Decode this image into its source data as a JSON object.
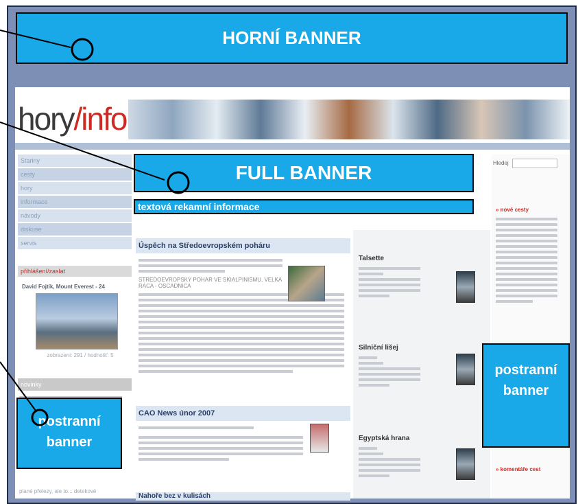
{
  "banners": {
    "top": "HORNÍ BANNER",
    "full": "FULL BANNER",
    "text_info": "textová rekamní informace",
    "side_left_line1": "postranní",
    "side_left_line2": "banner",
    "side_right_line1": "postranní",
    "side_right_line2": "banner"
  },
  "site": {
    "logo_part1": "hory",
    "logo_slash": "/",
    "logo_part2": "info",
    "nav": [
      "Stariny",
      "cesty",
      "hory",
      "informace",
      "návody",
      "diskuse",
      "servis"
    ],
    "left_head": "přihlášení/zaslat",
    "photo_caption": "David Fojtík, Mount Everest - 24",
    "photo_sub": "zobrazeni: 291 / hodnotiť: 5",
    "left_head2": "novinky",
    "left_bottom": "plané přelezy, ale to... detekové",
    "articles": [
      {
        "title": "Úspěch na Středoevropském poháru"
      },
      {
        "title": "CAO News únor 2007"
      },
      {
        "title": "Nahoře bez v kulisách"
      }
    ],
    "article1_lead": "STREDOEVROPSKY POHAR VE SKIALPINISMU, VELKA RACA - OSCADNICA",
    "routes": [
      {
        "title": "Talsette"
      },
      {
        "title": "Silniční lišej"
      },
      {
        "title": "Egyptská hrana"
      }
    ],
    "right_header": "» nové cesty",
    "right_header2": "» komentáře cest",
    "search_label": "Hledej"
  }
}
